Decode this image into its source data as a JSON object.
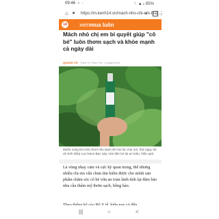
{
  "status": {
    "time": "09:46",
    "right": "⁙ ▲ ᵢₗ 85%"
  },
  "browser": {
    "url": "https://m.kenh14.vn/mach-nho-chi-em-bi-q...",
    "home_icon": "home-icon",
    "lock_icon": "lock-icon",
    "new_tab_icon": "plus-icon",
    "tab_count": "1",
    "menu_icon": "more-vert-icon"
  },
  "site": {
    "logo": "14",
    "brand_prefix": "xem",
    "brand_main": "mua luôn"
  },
  "article": {
    "title": "Mách nhỏ chị em bí quyết giúp \"cô bé\" luôn thơm sạch và khỏe mạnh cả ngày dài",
    "author": "QUANG VŨ",
    "category": "Theo Trí Thức Trẻ",
    "time_ago": "3 ngày trước",
    "caption": "Muốn vùng kín luôn thơm tho sạch sẽ mọi lúc mọi nơi, thử ngay Xịt vệ sinh Diệp Lục Nano Bạc này, vừa tiện lợi lại an toàn, hiệu quả.",
    "paragraph": "Là vùng nhạy cảm và cực kỳ quan trọng, thế nhưng nhiều chị em vẫn chưa tìm kiếm được cho mình sản phẩm chăm sóc cô bé vừa an toàn lành tính lại đảm bảo nhu cầu thẩm mỹ thơm sạch, hồng hào.",
    "next_line": "Theo thống kê của Bộ Y tế, hiện nay có đến"
  },
  "nav": {
    "recent": "|||",
    "home": "○",
    "back": "<"
  }
}
